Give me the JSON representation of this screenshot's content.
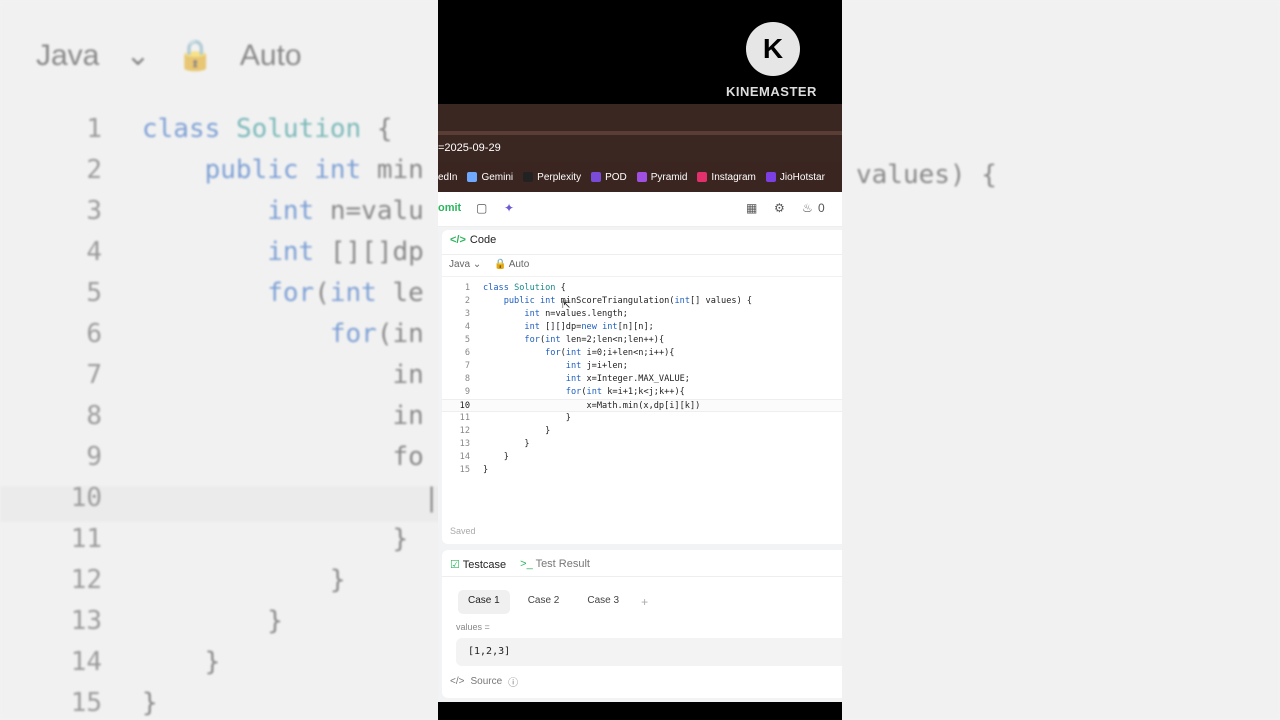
{
  "background": {
    "language": "Java",
    "lock_label": "Auto",
    "lines": [
      {
        "n": "1",
        "t": "class Solution {"
      },
      {
        "n": "2",
        "t": "    public int min"
      },
      {
        "n": "3",
        "t": "        int n=valu"
      },
      {
        "n": "4",
        "t": "        int [][]dp"
      },
      {
        "n": "5",
        "t": "        for(int le"
      },
      {
        "n": "6",
        "t": "            for(in"
      },
      {
        "n": "7",
        "t": "                in"
      },
      {
        "n": "8",
        "t": "                in"
      },
      {
        "n": "9",
        "t": "                fo"
      },
      {
        "n": "10",
        "t": "                  |"
      },
      {
        "n": "11",
        "t": "                }"
      },
      {
        "n": "12",
        "t": "            }"
      },
      {
        "n": "13",
        "t": "        }"
      },
      {
        "n": "14",
        "t": "    }"
      },
      {
        "n": "15",
        "t": "}"
      }
    ],
    "right_lines": [
      "values) {"
    ]
  },
  "watermark": {
    "name": "KINEMASTER",
    "letter": "K"
  },
  "browser": {
    "url": "=2025-09-29",
    "bookmarks": [
      {
        "label": "edIn",
        "color": "#3b2520"
      },
      {
        "label": "Gemini",
        "color": "#6fa8ff"
      },
      {
        "label": "Perplexity",
        "color": "#222222"
      },
      {
        "label": "POD",
        "color": "#7a4ad8"
      },
      {
        "label": "Pyramid",
        "color": "#a050e0"
      },
      {
        "label": "Instagram",
        "color": "#e1306c"
      },
      {
        "label": "JioHotstar",
        "color": "#7b3fe4"
      }
    ]
  },
  "toolbar": {
    "submit_label": "omit",
    "streak": "0"
  },
  "editor": {
    "title": "Code",
    "language": "Java",
    "mode": "Auto",
    "status": "Saved",
    "lines": [
      {
        "n": "1",
        "t": "class Solution {"
      },
      {
        "n": "2",
        "t": "    public int minScoreTriangulation(int[] values) {"
      },
      {
        "n": "3",
        "t": "        int n=values.length;"
      },
      {
        "n": "4",
        "t": "        int [][]dp=new int[n][n];"
      },
      {
        "n": "5",
        "t": "        for(int len=2;len<n;len++){"
      },
      {
        "n": "6",
        "t": "            for(int i=0;i+len<n;i++){"
      },
      {
        "n": "7",
        "t": "                int j=i+len;"
      },
      {
        "n": "8",
        "t": "                int x=Integer.MAX_VALUE;"
      },
      {
        "n": "9",
        "t": "                for(int k=i+1;k<j;k++){"
      },
      {
        "n": "10",
        "t": "                    x=Math.min(x,dp[i][k])"
      },
      {
        "n": "11",
        "t": "                }"
      },
      {
        "n": "12",
        "t": "            }"
      },
      {
        "n": "13",
        "t": "        }"
      },
      {
        "n": "14",
        "t": "    }"
      },
      {
        "n": "15",
        "t": "}"
      }
    ]
  },
  "testcase": {
    "tab_testcase": "Testcase",
    "tab_result": "Test Result",
    "cases": [
      "Case 1",
      "Case 2",
      "Case 3"
    ],
    "input_label": "values =",
    "input_value": "[1,2,3]",
    "source_label": "Source"
  }
}
